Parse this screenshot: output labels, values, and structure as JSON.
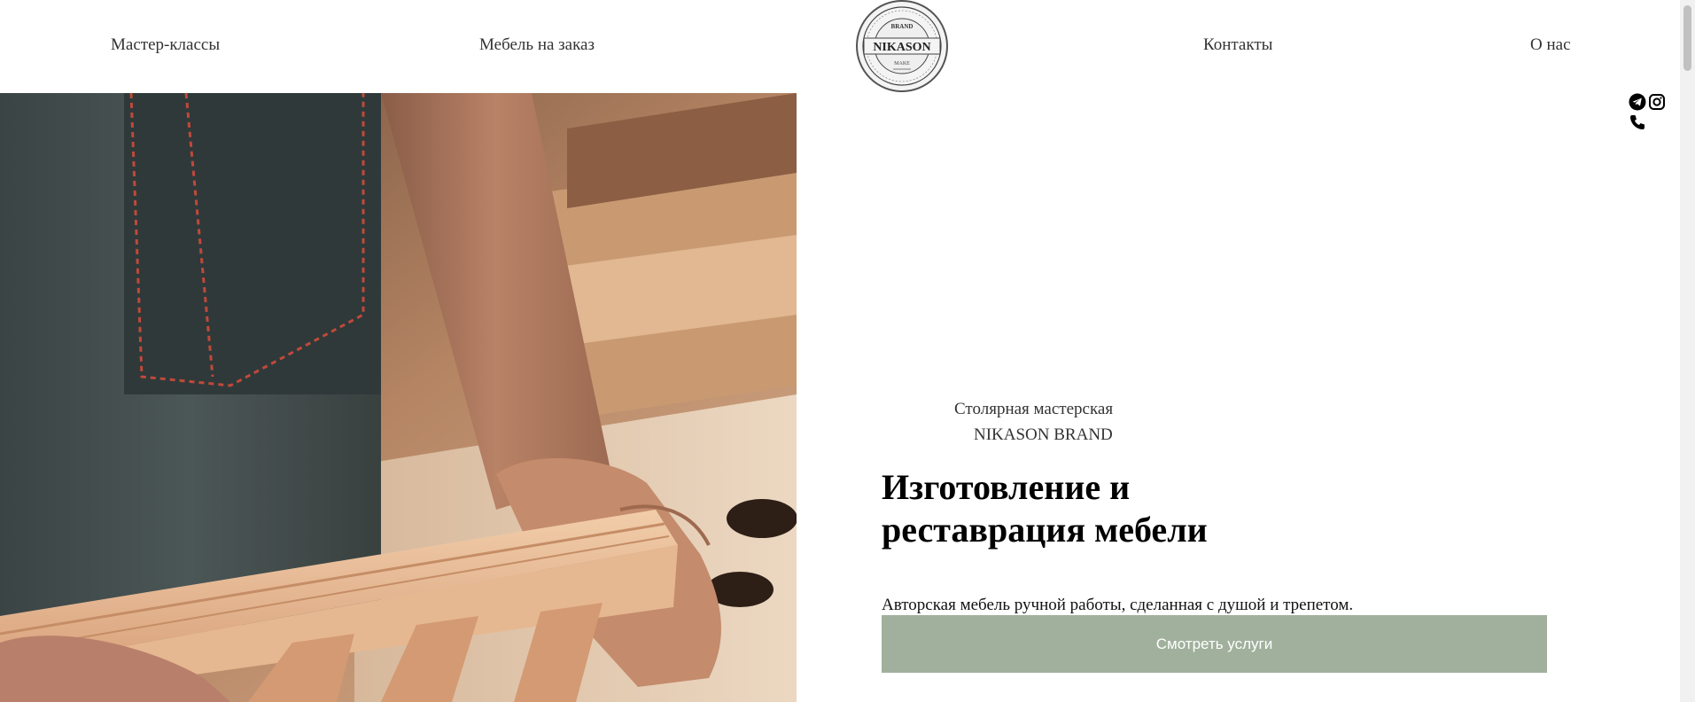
{
  "nav": {
    "items": [
      {
        "label": "Мастер-классы"
      },
      {
        "label": "Мебель на заказ"
      },
      {
        "label": "Контакты"
      },
      {
        "label": "О нас"
      }
    ]
  },
  "logo": {
    "brand_text": "NIKASON",
    "top_text": "BRAND",
    "bottom_text": "MAKE"
  },
  "hero": {
    "subtitle_line1": "Столярная мастерская",
    "subtitle_line2": "NIKASON BRAND",
    "headline": "Изготовление и реставрация мебели",
    "description": "Авторская мебель ручной работы, сделанная с душой и трепетом.",
    "cta_label": "Смотреть услуги"
  },
  "social": {
    "icons": [
      "telegram-icon",
      "instagram-icon",
      "phone-icon"
    ]
  },
  "colors": {
    "cta_background": "#a0b09c",
    "cta_text": "#ffffff",
    "background": "#ffffff",
    "text": "#222222"
  }
}
